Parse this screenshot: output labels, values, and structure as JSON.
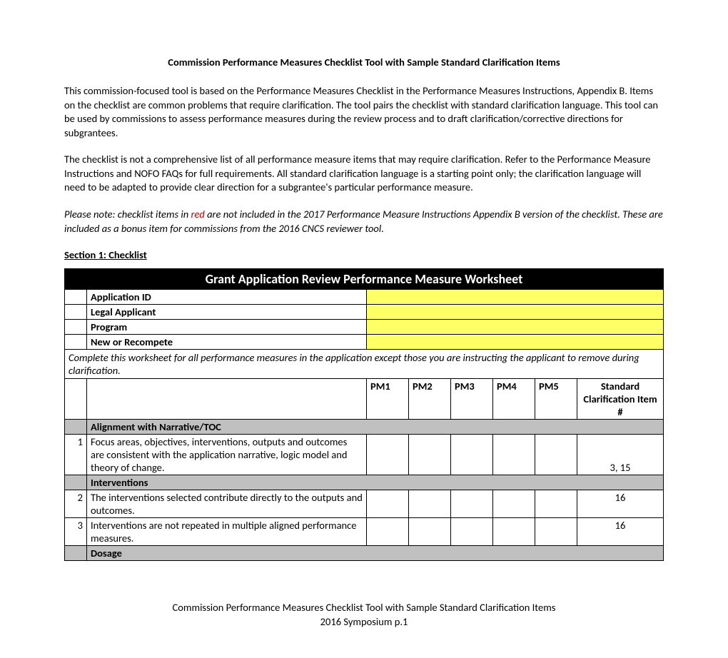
{
  "title": "Commission Performance Measures Checklist Tool with Sample Standard Clarification Items",
  "para1": "This commission-focused tool is based on the Performance Measures Checklist in the Performance Measures Instructions, Appendix B. Items on the checklist are common problems that require clarification.  The tool pairs the checklist with standard clarification language.  This tool can be used by commissions to assess performance measures during the review process and to draft clarification/corrective directions for subgrantees.",
  "para2": "The checklist is not a comprehensive list of all performance measure items that may require clarification.  Refer to the Performance Measure Instructions and NOFO FAQs for full requirements. All standard clarification language is a starting point only; the clarification language will need to be adapted to provide clear direction for a subgrantee's particular performance measure.",
  "note_prefix": "Please note: checklist items in ",
  "note_red": "red",
  "note_suffix": " are not included in the 2017 Performance Measure Instructions Appendix B version of the checklist. These are included as a bonus item for commissions from the 2016 CNCS reviewer tool.",
  "section1": "Section 1: Checklist",
  "table_title": "Grant Application Review Performance Measure Worksheet",
  "rows": {
    "app_id": "Application ID",
    "legal": "Legal Applicant",
    "program": "Program",
    "new_recompete": "New or Recompete"
  },
  "instruction": "Complete this worksheet for all performance measures in the application except those you are instructing the applicant to remove during clarification.",
  "pm": {
    "1": "PM1",
    "2": "PM2",
    "3": "PM3",
    "4": "PM4",
    "5": "PM5"
  },
  "std_head": "Standard Clarification Item #",
  "sections": {
    "alignment": "Alignment with Narrative/TOC",
    "interventions": "Interventions",
    "dosage": "Dosage"
  },
  "items": {
    "1": {
      "num": "1",
      "text": "Focus areas, objectives, interventions, outputs and outcomes are consistent with the application narrative, logic model and theory of change.",
      "std": "3, 15"
    },
    "2": {
      "num": "2",
      "text": "The interventions selected contribute directly to the outputs and outcomes.",
      "std": "16"
    },
    "3": {
      "num": "3",
      "text": "Interventions are not repeated in multiple aligned performance measures.",
      "std": "16"
    }
  },
  "footer1": "Commission Performance Measures Checklist Tool with Sample Standard Clarification Items",
  "footer2": "2016 Symposium p.1"
}
